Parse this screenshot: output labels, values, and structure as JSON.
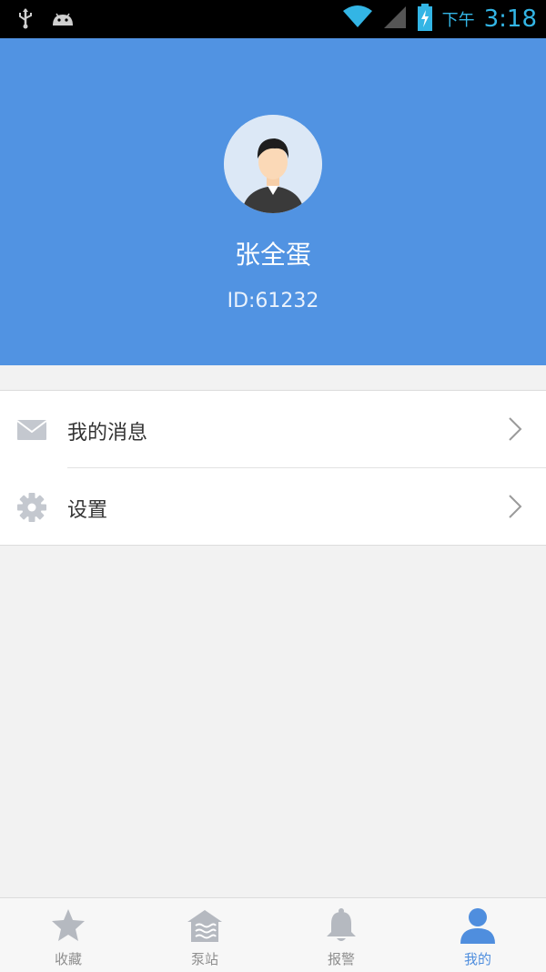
{
  "status_bar": {
    "ampm": "下午",
    "time": "3:18",
    "icons": [
      "usb-icon",
      "android-icon",
      "wifi-icon",
      "signal-icon",
      "battery-charging-icon"
    ]
  },
  "profile": {
    "name": "张全蛋",
    "id": "ID:61232",
    "avatar_icon": "user-avatar-icon"
  },
  "menu": {
    "items": [
      {
        "label": "我的消息",
        "icon": "mail-icon"
      },
      {
        "label": "设置",
        "icon": "gear-icon"
      }
    ]
  },
  "bottom_nav": {
    "tabs": [
      {
        "label": "收藏",
        "icon": "star-icon",
        "active": false
      },
      {
        "label": "泵站",
        "icon": "pump-station-icon",
        "active": false
      },
      {
        "label": "报警",
        "icon": "bell-icon",
        "active": false
      },
      {
        "label": "我的",
        "icon": "person-icon",
        "active": true
      }
    ]
  },
  "colors": {
    "header_bg": "#5193e2",
    "accent": "#4f8ede",
    "inactive_icon": "#b5b9c0",
    "status_time": "#33b5e5"
  }
}
